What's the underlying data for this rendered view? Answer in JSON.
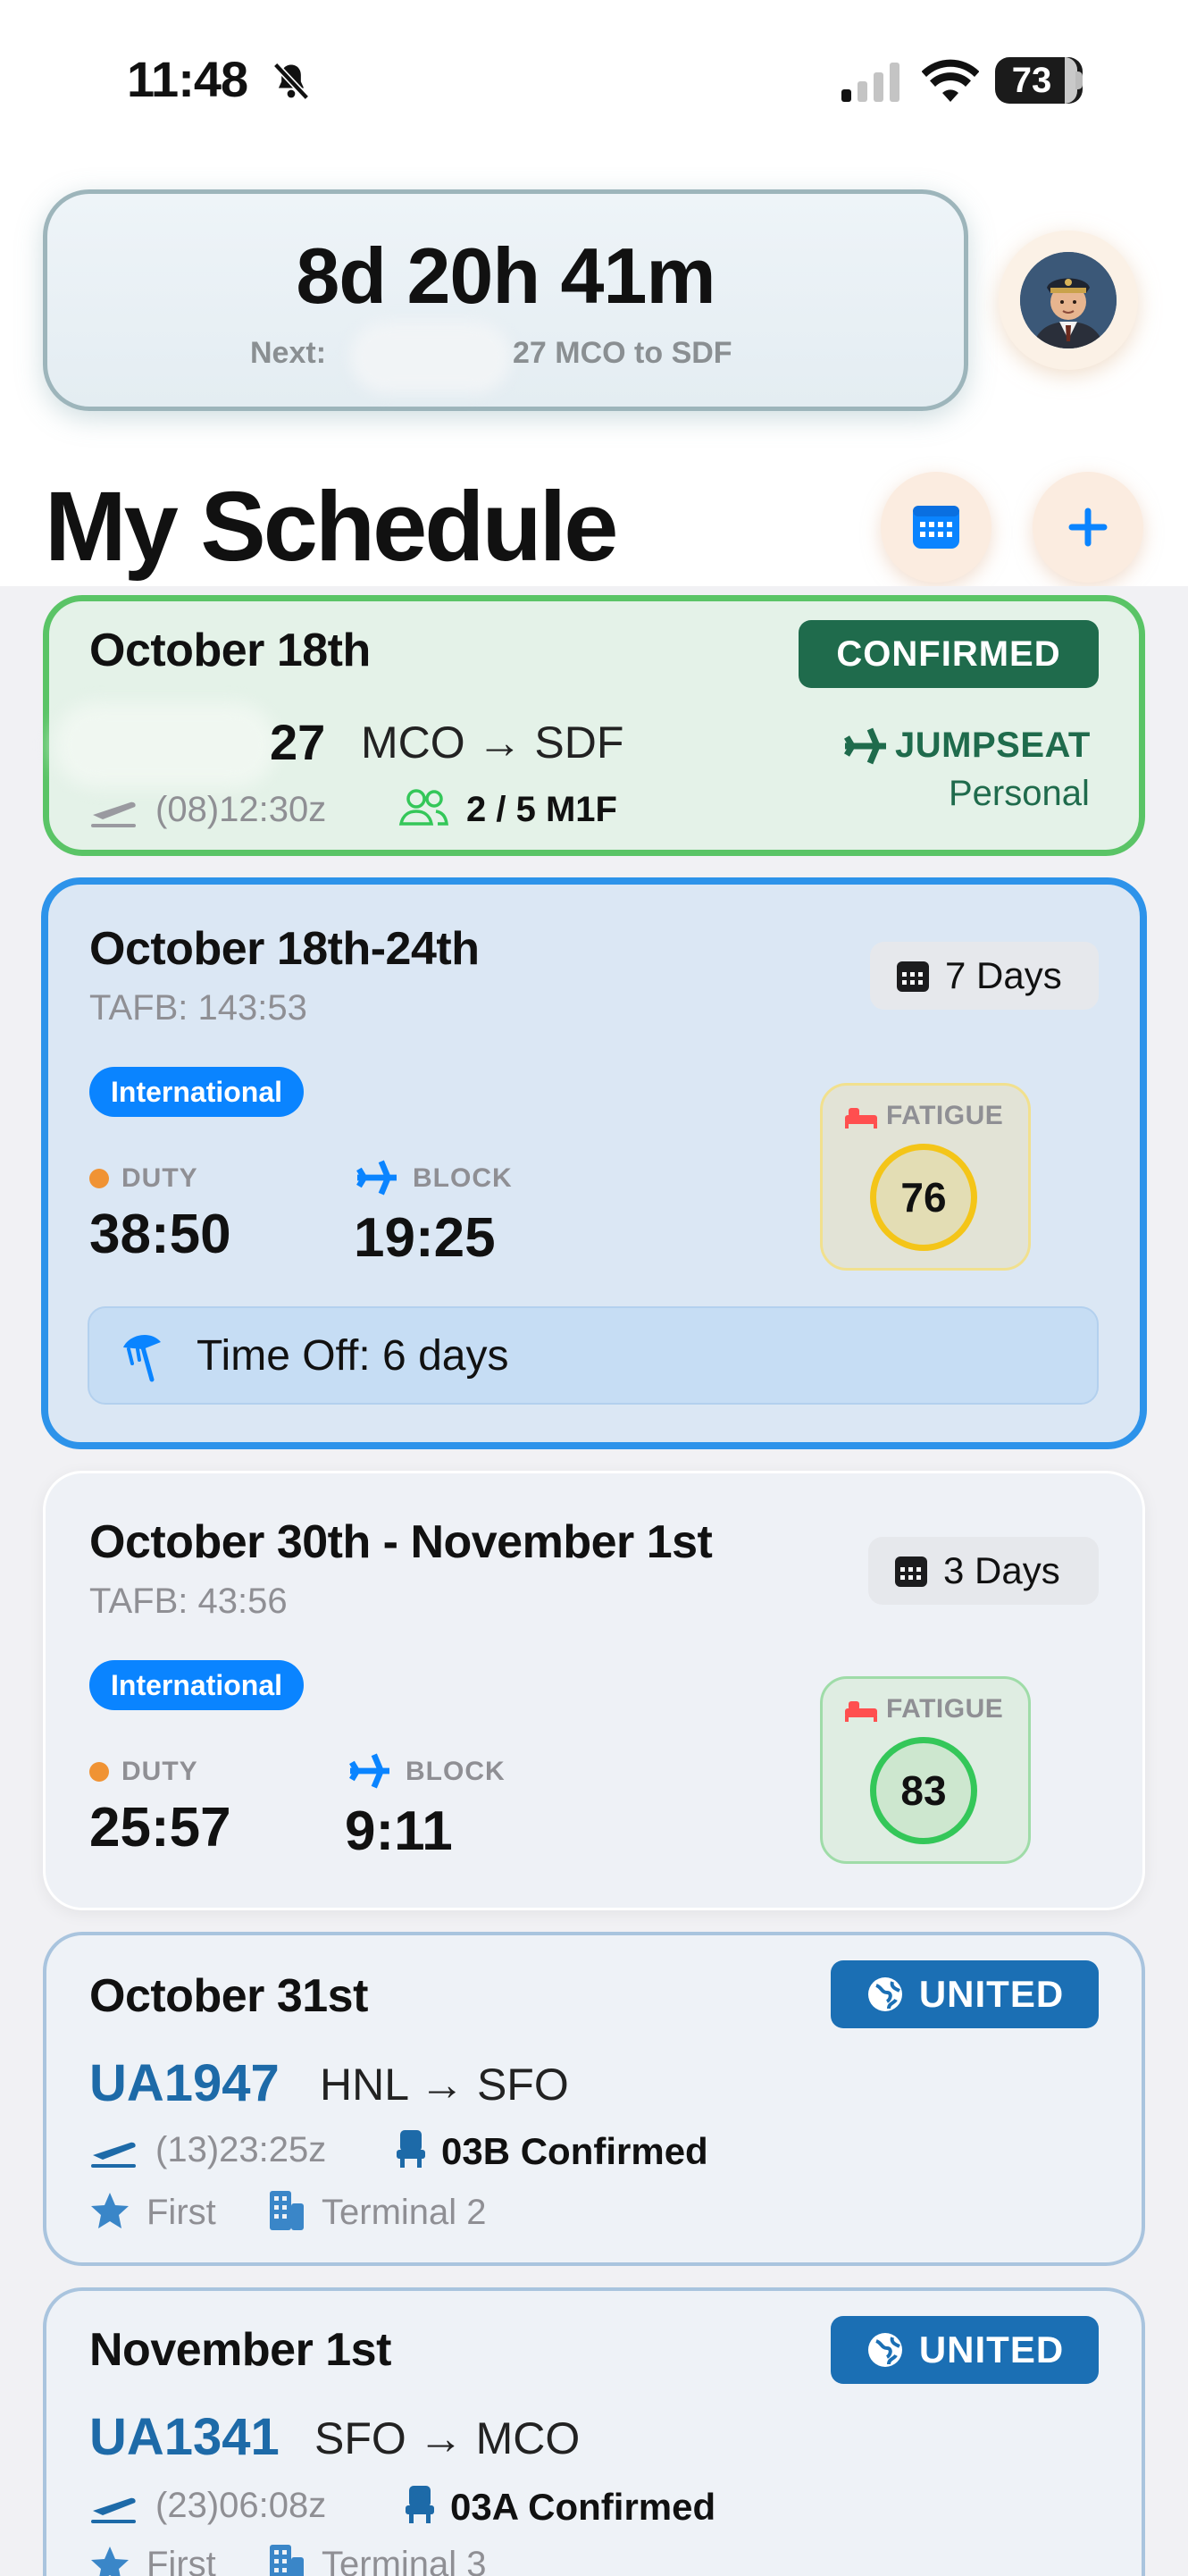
{
  "status_bar": {
    "time": "11:48",
    "battery": "73"
  },
  "countdown": {
    "value": "8d 20h 41m",
    "next_label": "Next:",
    "next_value": "27 MCO to SDF"
  },
  "page_title": "My Schedule",
  "cards": {
    "jumpseat": {
      "date": "October 18th",
      "badge": "CONFIRMED",
      "flight_number": "27",
      "route": "MCO → SDF",
      "departure": "(08)12:30z",
      "seats": "2 / 5 M1F",
      "type": "JUMPSEAT",
      "purpose": "Personal"
    },
    "trip1": {
      "date": "October 18th-24th",
      "tafb": "TAFB: 143:53",
      "days": "7 Days",
      "tag": "International",
      "duty_label": "DUTY",
      "duty": "38:50",
      "block_label": "BLOCK",
      "block": "19:25",
      "fatigue_label": "FATIGUE",
      "fatigue": "76",
      "time_off": "Time Off: 6 days"
    },
    "trip2": {
      "date": "October 30th - November 1st",
      "tafb": "TAFB: 43:56",
      "days": "3 Days",
      "tag": "International",
      "duty_label": "DUTY",
      "duty": "25:57",
      "block_label": "BLOCK",
      "block": "9:11",
      "fatigue_label": "FATIGUE",
      "fatigue": "83"
    },
    "flight1": {
      "date": "October 31st",
      "airline": "UNITED",
      "flight_number": "UA1947",
      "route": "HNL → SFO",
      "departure": "(13)23:25z",
      "seat": "03B Confirmed",
      "cabin": "First",
      "terminal": "Terminal 2"
    },
    "flight2": {
      "date": "November 1st",
      "airline": "UNITED",
      "flight_number": "UA1341",
      "route": "SFO → MCO",
      "departure": "(23)06:08z",
      "seat": "03A Confirmed",
      "cabin": "First",
      "terminal": "Terminal 3"
    }
  },
  "colors": {
    "accent": "#0a84ff",
    "confirmed": "#1f6b4c",
    "united": "#1b6fb4"
  }
}
